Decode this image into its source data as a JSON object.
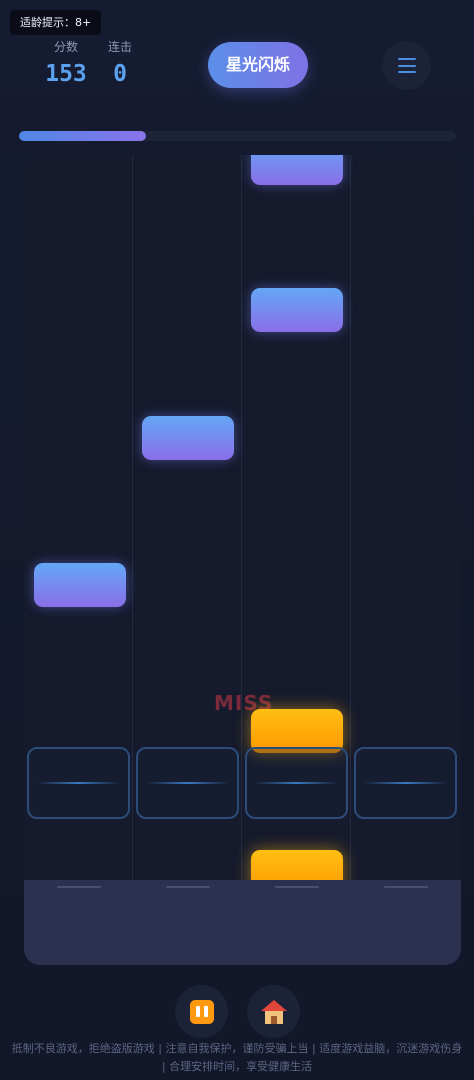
{
  "header": {
    "age_rating": "适龄提示：8+",
    "score_label": "分数",
    "score_value": "153",
    "combo_label": "连击",
    "combo_value": "0",
    "song_title": "星光闪烁",
    "menu_icon": "hamburger-menu-icon"
  },
  "progress": {
    "fraction": 0.29
  },
  "field": {
    "lanes": 4,
    "judgement": "MISS",
    "hit_zone_count": 4
  },
  "controls": {
    "pause_icon": "pause-icon",
    "home_icon": "home-icon"
  },
  "footer": {
    "notice": "抵制不良游戏，拒绝盗版游戏 | 注意自我保护，谨防受骗上当 | 适度游戏益脑，沉迷游戏伤身 | 合理安排时间，享受健康生活"
  },
  "colors": {
    "background": "#141a2e",
    "accent_blue": "#5aa2ee",
    "note_blue_top": "#63a7f5",
    "note_blue_bottom": "#8a6ee9",
    "note_gold": "#ffb20e",
    "miss_red": "#7a2a3a"
  }
}
